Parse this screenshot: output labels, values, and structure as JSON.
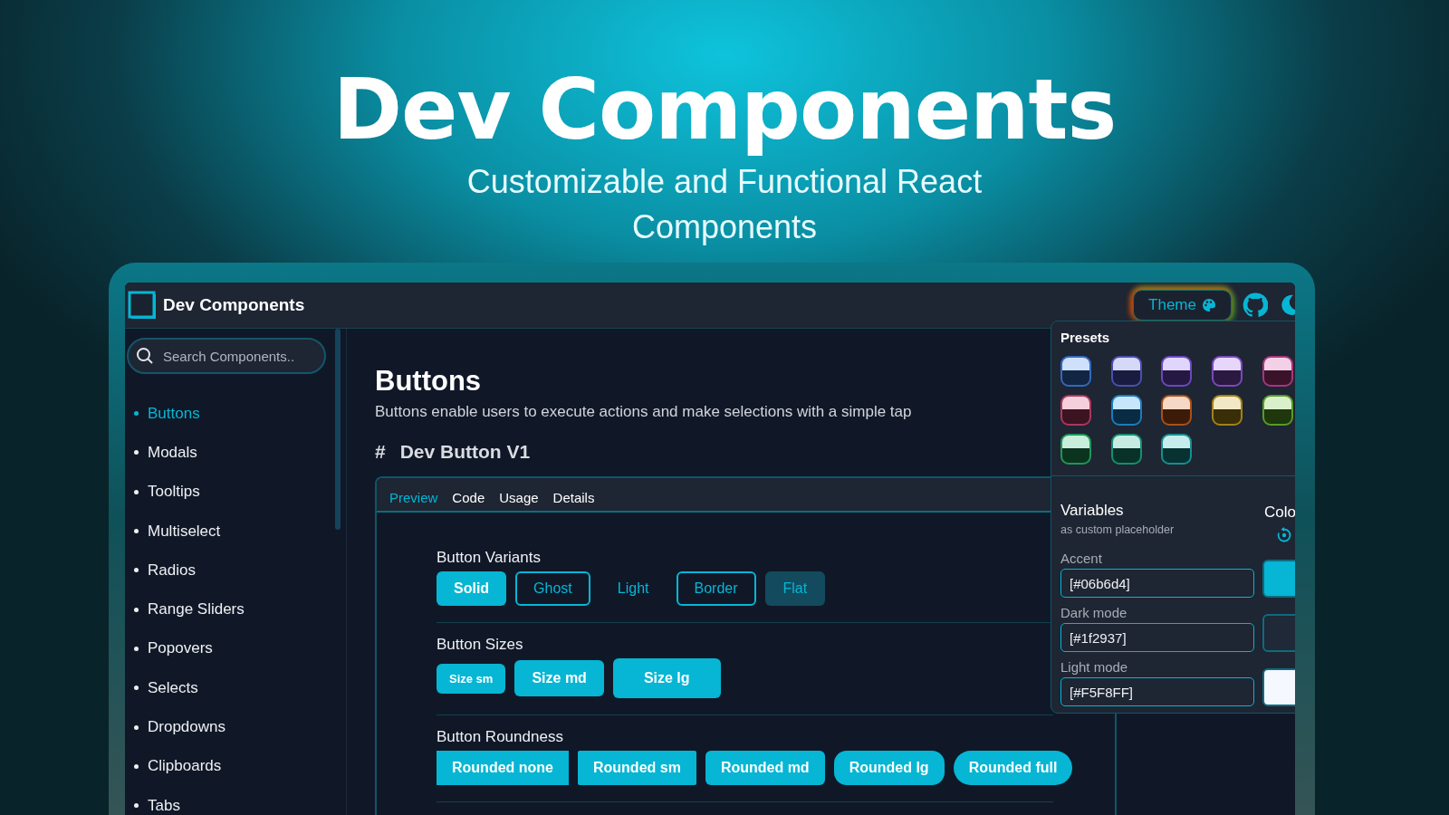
{
  "hero": {
    "title": "Dev Components",
    "subtitle": "Customizable and Functional React Components"
  },
  "app": {
    "brand": "Dev Components",
    "theme_button": "Theme"
  },
  "search": {
    "placeholder": "Search Components.."
  },
  "sidebar": {
    "items": [
      {
        "label": "Buttons",
        "selected": true
      },
      {
        "label": "Modals",
        "selected": false
      },
      {
        "label": "Tooltips",
        "selected": false
      },
      {
        "label": "Multiselect",
        "selected": false
      },
      {
        "label": "Radios",
        "selected": false
      },
      {
        "label": "Range Sliders",
        "selected": false
      },
      {
        "label": "Popovers",
        "selected": false
      },
      {
        "label": "Selects",
        "selected": false
      },
      {
        "label": "Dropdowns",
        "selected": false
      },
      {
        "label": "Clipboards",
        "selected": false
      },
      {
        "label": "Tabs",
        "selected": false
      }
    ]
  },
  "page": {
    "title": "Buttons",
    "description": "Buttons enable users to execute actions and make selections with a simple tap",
    "section_mark": "#",
    "section_title": "Dev Button V1"
  },
  "tabs": [
    {
      "label": "Preview",
      "selected": true
    },
    {
      "label": "Code",
      "selected": false
    },
    {
      "label": "Usage",
      "selected": false
    },
    {
      "label": "Details",
      "selected": false
    }
  ],
  "groups": [
    {
      "title": "Button Variants",
      "buttons": [
        {
          "label": "Solid",
          "kind": "solid"
        },
        {
          "label": "Ghost",
          "kind": "ghost"
        },
        {
          "label": "Light",
          "kind": "light"
        },
        {
          "label": "Border",
          "kind": "border"
        },
        {
          "label": "Flat",
          "kind": "flat"
        }
      ]
    },
    {
      "title": "Button Sizes",
      "buttons": [
        {
          "label": "Size sm",
          "kind": "sm"
        },
        {
          "label": "Size md",
          "kind": "md"
        },
        {
          "label": "Size lg",
          "kind": "lg"
        }
      ]
    },
    {
      "title": "Button Roundness",
      "buttons": [
        {
          "label": "Rounded none",
          "kind": "r-none"
        },
        {
          "label": "Rounded sm",
          "kind": "r-sm"
        },
        {
          "label": "Rounded md",
          "kind": "r-md"
        },
        {
          "label": "Rounded lg",
          "kind": "r-lg"
        },
        {
          "label": "Rounded full",
          "kind": "r-full"
        }
      ]
    }
  ],
  "theme_panel": {
    "presets_title": "Presets",
    "presets": [
      {
        "color": "#cfe0fb"
      },
      {
        "color": "#d6d8f7"
      },
      {
        "color": "#e0d6fb"
      },
      {
        "color": "#e6d6fa"
      },
      {
        "color": "#f3d0e6"
      },
      {
        "color": "#f5d0dc"
      },
      {
        "color": "#c7e6fb"
      },
      {
        "color": "#f5d8c6"
      },
      {
        "color": "#f2e8c6"
      },
      {
        "color": "#daf0cb"
      },
      {
        "color": "#c9eedb"
      },
      {
        "color": "#c6ece2"
      },
      {
        "color": "#c6ecec"
      }
    ],
    "variables_title": "Variables",
    "variables_note": "as custom placeholder",
    "colors_title": "Colo",
    "variables": [
      {
        "label": "Accent",
        "value": "[#06b6d4]",
        "color": "#06b6d4"
      },
      {
        "label": "Dark mode",
        "value": "[#1f2937]",
        "color": "#1f2937"
      },
      {
        "label": "Light mode",
        "value": "[#F5F8FF]",
        "color": "#f5f8ff"
      }
    ]
  }
}
